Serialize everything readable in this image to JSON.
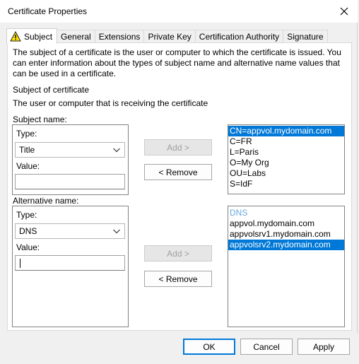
{
  "window": {
    "title": "Certificate Properties"
  },
  "tabs": [
    {
      "label": "Subject",
      "active": true
    },
    {
      "label": "General"
    },
    {
      "label": "Extensions"
    },
    {
      "label": "Private Key"
    },
    {
      "label": "Certification Authority"
    },
    {
      "label": "Signature"
    }
  ],
  "description": "The subject of a certificate is the user or computer to which the certificate is issued. You can enter information about the types of subject name and alternative name values that can be used in a certificate.",
  "subject_of_certificate": {
    "heading": "Subject of certificate",
    "subtext": "The user or computer that is receiving the certificate"
  },
  "subject_name": {
    "group_label": "Subject name:",
    "type_label": "Type:",
    "type_value": "Title",
    "value_label": "Value:",
    "value": "",
    "add_label": "Add >",
    "remove_label": "< Remove",
    "list": [
      "CN=appvol.mydomain.com",
      "C=FR",
      "L=Paris",
      "O=My Org",
      "OU=Labs",
      "S=IdF"
    ],
    "selected_index": 0
  },
  "alternative_name": {
    "group_label": "Alternative name:",
    "type_label": "Type:",
    "type_value": "DNS",
    "value_label": "Value:",
    "value": "",
    "add_label": "Add >",
    "remove_label": "< Remove",
    "list_header": "DNS",
    "list": [
      "appvol.mydomain.com",
      "appvolsrv1.mydomain.com",
      "appvolsrv2.mydomain.com"
    ],
    "selected_index": 2
  },
  "footer": {
    "ok_label": "OK",
    "cancel_label": "Cancel",
    "apply_label": "Apply"
  },
  "colors": {
    "selection": "#0078d7",
    "default_button_border": "#0078d7"
  },
  "icons": {
    "close": "close-icon",
    "warning": "warning-icon",
    "dropdown": "chevron-down-icon"
  }
}
